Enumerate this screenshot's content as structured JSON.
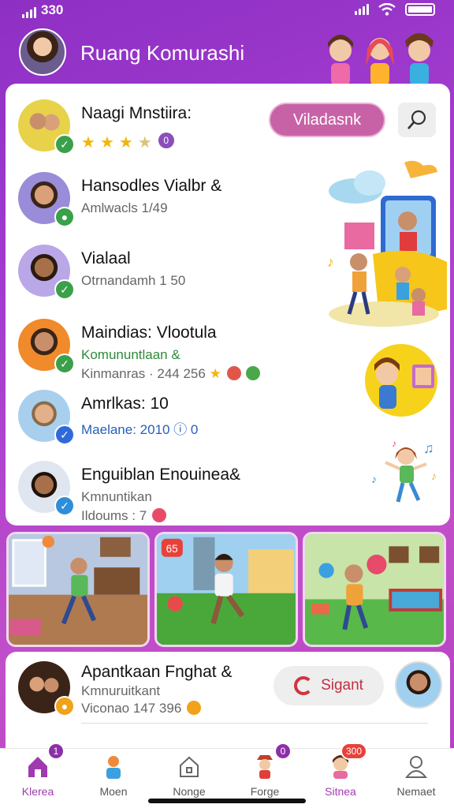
{
  "status_bar": {
    "time": "330"
  },
  "header": {
    "title": "Ruang Komurashi"
  },
  "main_card": {
    "rows": [
      {
        "title": "Naagi Mnstiira:",
        "rating": 4,
        "rating_badge": "0",
        "cta_label": "Viladasnk"
      },
      {
        "title": "Hansodles Vialbr  &",
        "subtitle": "Amlwacls 1/49"
      },
      {
        "title": "Vialaal",
        "subtitle": "Otrnandamh 1 50"
      },
      {
        "title": "Maindias: Vlootula",
        "subtitle": "Komununtlaan  &",
        "subtitle2": "Kinmanras · 244 256"
      },
      {
        "title": "Amrlkas: 10",
        "subtitle": "Maelane: 2010 ⓘ 0"
      },
      {
        "title": "Enguiblan Enouinea&",
        "subtitle": "Kmnuntikan",
        "subtitle2": "Ildoums : 7"
      }
    ]
  },
  "photo_badge": "65",
  "bottom_card": {
    "title": "Apantkaan Fnghat  &",
    "subtitle": "Kmnuruitkant",
    "subtitle2": "Viconao 147 396",
    "signup_label": "Sigant"
  },
  "tabs": [
    {
      "label": "Klerea",
      "icon": "home-icon",
      "active": true,
      "badge": "1"
    },
    {
      "label": "Moen",
      "icon": "people-icon",
      "active": false
    },
    {
      "label": "Nonge",
      "icon": "house-outline-icon",
      "active": false
    },
    {
      "label": "Forge",
      "icon": "character-icon",
      "active": false,
      "badge": "0"
    },
    {
      "label": "Sitnea",
      "icon": "avatar-icon",
      "active": false,
      "badge": "300"
    },
    {
      "label": "Nemaet",
      "icon": "profile-icon",
      "active": false
    }
  ],
  "colors": {
    "accent": "#a63ed0",
    "cta": "#c862a6",
    "tab_active": "#a03ab0"
  }
}
